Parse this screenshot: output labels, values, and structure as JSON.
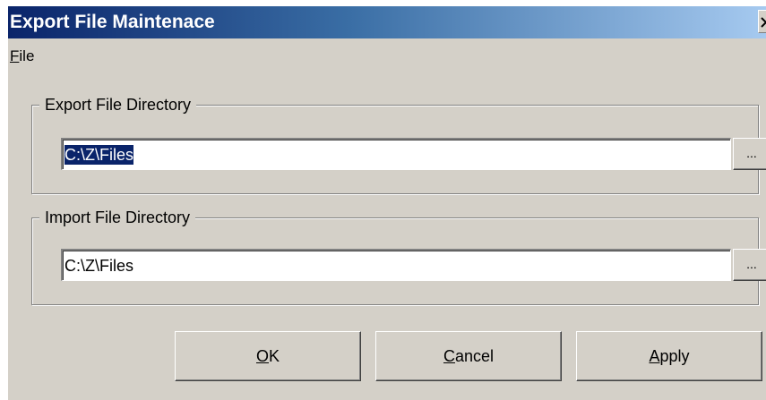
{
  "window": {
    "title": "Export File Maintenace",
    "close_glyph": "×"
  },
  "menubar": {
    "items": [
      {
        "mnemonic": "F",
        "rest": "ile"
      }
    ]
  },
  "export_group": {
    "legend": "Export File Directory",
    "path_value": "C:\\Z\\Files",
    "path_selected": true,
    "browse_label": "..."
  },
  "import_group": {
    "legend": "Import File Directory",
    "path_value": "C:\\Z\\Files",
    "browse_label": "..."
  },
  "buttons": {
    "ok": {
      "mnemonic": "O",
      "rest": "K"
    },
    "cancel": {
      "mnemonic": "C",
      "rest": "ancel"
    },
    "apply": {
      "mnemonic": "A",
      "rest": "pply"
    }
  },
  "icons": {
    "close": "close-icon"
  },
  "colors": {
    "titlebar_start": "#0a246a",
    "titlebar_end": "#a6caf0",
    "dialog_face": "#d4d0c8",
    "selection": "#0a246a"
  }
}
